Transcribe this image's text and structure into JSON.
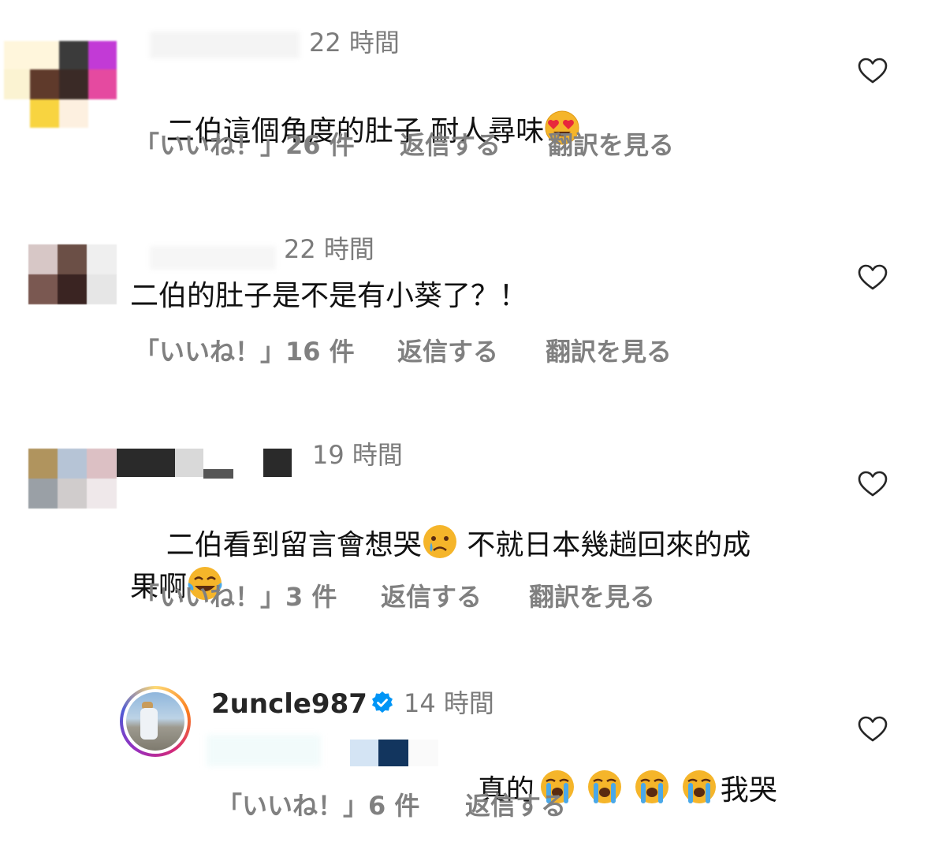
{
  "comments": [
    {
      "time": "22 時間",
      "text": "二伯這個角度的肚子 耐人尋味",
      "emoji": "heart-eyes",
      "likes": "「いいね！」26 件",
      "reply": "返信する",
      "translate": "翻訳を見る"
    },
    {
      "time": "22 時間",
      "text": "二伯的肚子是不是有小葵了？！",
      "likes": "「いいね！」16 件",
      "reply": "返信する",
      "translate": "翻訳を見る"
    },
    {
      "time": "19 時間",
      "text_part1": "二伯看到留言會想哭",
      "text_part2": " 不就日本幾趟回來的成",
      "text_part3": "果啊",
      "likes": "「いいね！」3 件",
      "reply": "返信する",
      "translate": "翻訳を見る"
    },
    {
      "username": "2uncle987",
      "verified": true,
      "time": "14 時間",
      "text_part1": "真的",
      "text_part2": "我哭",
      "likes": "「いいね！」6 件",
      "reply": "返信する"
    }
  ],
  "colors": {
    "verified": "#0095f6",
    "muted": "#808080"
  },
  "icons": [
    "heart-icon",
    "verified-badge-icon"
  ]
}
